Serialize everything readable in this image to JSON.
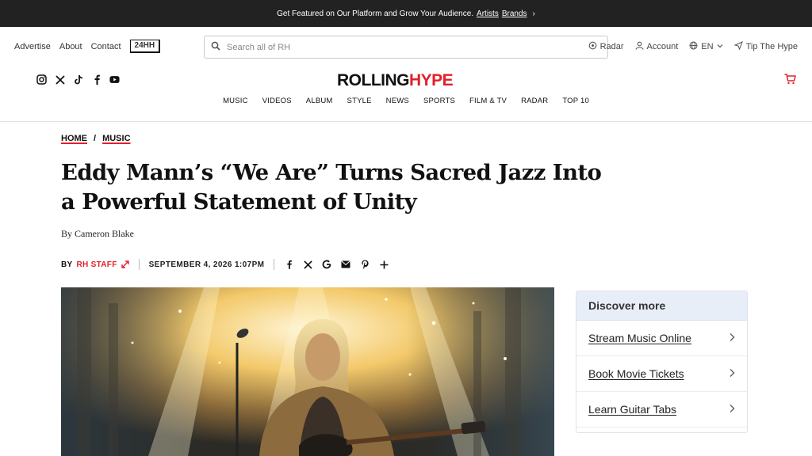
{
  "topbar": {
    "text": "Get Featured on Our Platform and Grow Your Audience.",
    "link1": "Artists",
    "link2": "Brands",
    "chevron": "›"
  },
  "utility": {
    "links": [
      "Advertise",
      "About",
      "Contact"
    ],
    "badge": "24HH",
    "search_placeholder": "Search all of RH",
    "right": {
      "radar": "Radar",
      "account": "Account",
      "lang": "EN",
      "tip": "Tip The Hype"
    }
  },
  "brand": {
    "logo_black": "ROLLING",
    "logo_red": "HYPE",
    "social_icons": [
      "instagram-icon",
      "x-icon",
      "tiktok-icon",
      "facebook-icon",
      "youtube-icon"
    ]
  },
  "nav": [
    "MUSIC",
    "VIDEOS",
    "ALBUM",
    "STYLE",
    "NEWS",
    "SPORTS",
    "FILM & TV",
    "RADAR",
    "TOP 10"
  ],
  "breadcrumb": {
    "home": "HOME",
    "sep": "/",
    "section": "MUSIC"
  },
  "article": {
    "title": "Eddy Mann’s “We Are” Turns Sacred Jazz Into a Powerful Statement of Unity",
    "byline": "By Cameron Blake",
    "meta_by": "BY",
    "meta_author": "RH STAFF",
    "date": "SEPTEMBER 4, 2026 1:07PM"
  },
  "discover": {
    "title": "Discover more",
    "items": [
      "Stream Music Online",
      "Book Movie Tickets",
      "Learn Guitar Tabs"
    ],
    "arrow": "›"
  },
  "colors": {
    "accent": "#e0202a",
    "topbar_bg": "#222222",
    "discover_head": "#e8eef8"
  }
}
